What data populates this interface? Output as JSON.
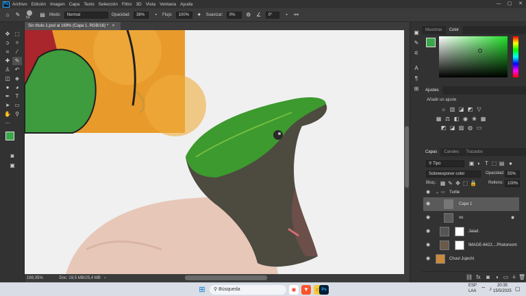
{
  "menubar": {
    "app_icon": "Ps",
    "items": [
      "Archivo",
      "Edición",
      "Imagen",
      "Capa",
      "Texto",
      "Selección",
      "Filtro",
      "3D",
      "Vista",
      "Ventana",
      "Ayuda"
    ],
    "win_controls": [
      "—",
      "▢",
      "✕"
    ]
  },
  "options_bar": {
    "brush_size": "54",
    "mode_label": "Modo:",
    "mode_value": "Normal",
    "opacity_label": "Opacidad:",
    "opacity_value": "38%",
    "flow_label": "Flujo:",
    "flow_value": "100%",
    "smooth_label": "Suavizar:",
    "smooth_value": "0%",
    "angle_value": "0°"
  },
  "document": {
    "tab_title": "Sin título-1.psd al 169% (Capa 1, RGB/16) *",
    "tab_close": "×",
    "zoom": "169,35%",
    "doc_info": "Doc: 19,5 MB/25,4 MB"
  },
  "color_panel": {
    "tabs": [
      "Muestras",
      "Color"
    ],
    "active_tab": "Color",
    "fg_color": "#3aa84a"
  },
  "adjustments_panel": {
    "title": "Ajustes",
    "add_label": "Añadir un ajuste"
  },
  "layers_panel": {
    "tabs": [
      "Capas",
      "Canales",
      "Trazados"
    ],
    "active_tab": "Capas",
    "filter_value": "Tipo",
    "blend_mode": "Sobreexponer color",
    "opacity_label": "Opacidad:",
    "opacity_value": "55%",
    "lock_label": "Bloq.:",
    "fill_label": "Relleno:",
    "fill_value": "100%",
    "layers": [
      {
        "name": "Turtle",
        "type": "group"
      },
      {
        "name": "Capa 1",
        "type": "layer",
        "selected": true
      },
      {
        "name": "vo",
        "type": "layer"
      },
      {
        "name": "Jaiad.",
        "type": "adjustment"
      },
      {
        "name": "IMAGE-6422....Photoroom",
        "type": "smart"
      },
      {
        "name": "Chuul Jujechi",
        "type": "layer"
      }
    ],
    "footer_icons": [
      "link-icon",
      "fx-icon",
      "mask-icon",
      "adjustment-icon",
      "folder-icon",
      "new-layer-icon",
      "trash-icon"
    ]
  },
  "taskbar": {
    "search_label": "Búsqueda",
    "lang": "ESP",
    "lang2": "LAA",
    "time": "20:35",
    "date": "15/5/2025"
  }
}
